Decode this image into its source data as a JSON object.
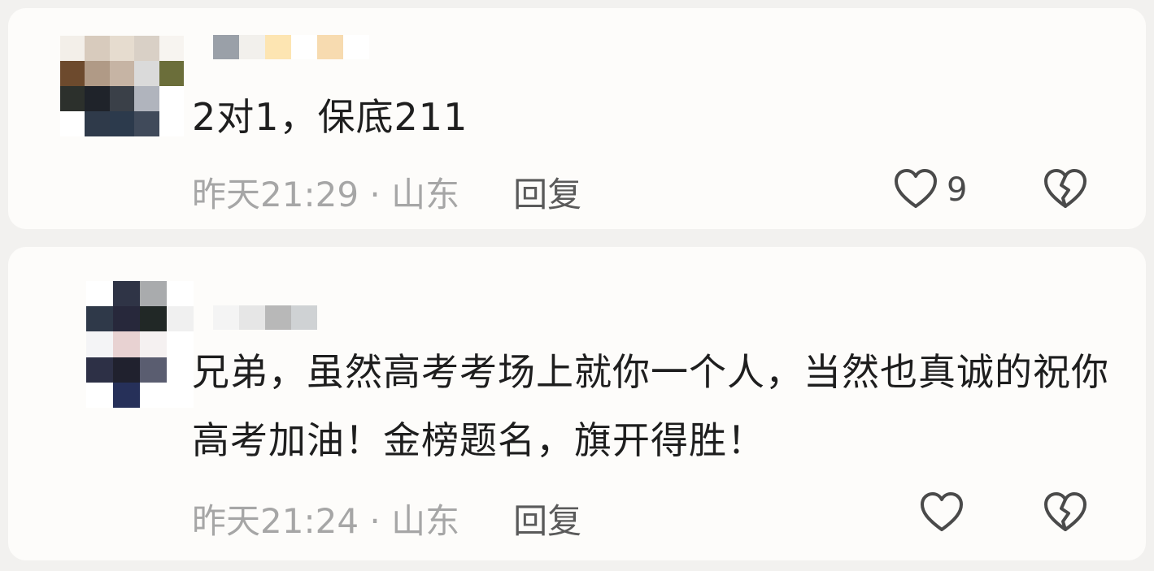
{
  "comments": [
    {
      "text": "2对1，保底211",
      "time_location": "昨天21:29 · 山东",
      "reply_label": "回复",
      "like_count": "9",
      "avatar_pixels": [
        "#f3efe9",
        "#d8cbbd",
        "#e6dccf",
        "#d9d0c6",
        "#f7f4f0",
        "#6d4a2d",
        "#b09a86",
        "#c6b4a4",
        "#dadada",
        "#6b6e3a",
        "#2c302c",
        "#1f232a",
        "#3a4048",
        "#b0b4bd",
        "#ffffff",
        "#ffffff",
        "#2f3a4a",
        "#2c3a4c",
        "#404a5a",
        "#ffffff"
      ],
      "nickname_pixels": [
        "#9aa0a8",
        "#f2f0ec",
        "#fde5b2",
        "#ffffff",
        "#f7dbb0",
        "#ffffff"
      ]
    },
    {
      "text": "兄弟，虽然高考考场上就你一个人，当然也真诚的祝你高考加油！金榜题名，旗开得胜！",
      "time_location": "昨天21:24 · 山东",
      "reply_label": "回复",
      "like_count": "",
      "avatar_pixels": [
        "#ffffff",
        "#2f3446",
        "#a9abad",
        "#ffffff",
        "#2f3949",
        "#27283b",
        "#212826",
        "#f0f0f0",
        "#f4f4f6",
        "#e8d2d2",
        "#f5f1f1",
        "#ffffff",
        "#2d3046",
        "#20212e",
        "#5a5d70",
        "#ffffff",
        "#ffffff",
        "#263059",
        "#ffffff",
        "#ffffff"
      ],
      "nickname_pixels": [
        "#f4f4f4",
        "#e6e6e6",
        "#b8b8b8",
        "#cfd2d4"
      ]
    }
  ],
  "icons": {
    "like": "heart-outline-icon",
    "dislike": "broken-heart-icon"
  },
  "colors": {
    "text": "#1e1e1e",
    "meta": "#a6a6a6",
    "reply": "#5a5a5a",
    "icon": "#4a4a4a",
    "card": "#fdfcfa",
    "page": "#f2f1ef"
  }
}
